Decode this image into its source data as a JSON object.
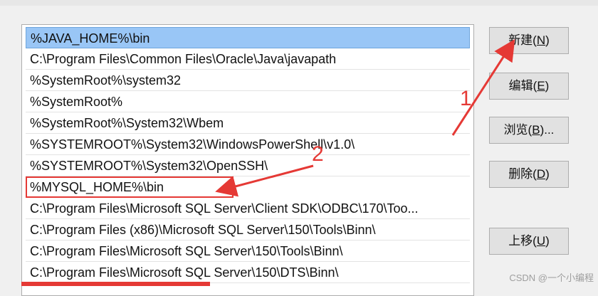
{
  "path_list": {
    "items": [
      "%JAVA_HOME%\\bin",
      "C:\\Program Files\\Common Files\\Oracle\\Java\\javapath",
      "%SystemRoot%\\system32",
      "%SystemRoot%",
      "%SystemRoot%\\System32\\Wbem",
      "%SYSTEMROOT%\\System32\\WindowsPowerShell\\v1.0\\",
      "%SYSTEMROOT%\\System32\\OpenSSH\\",
      "%MYSQL_HOME%\\bin",
      "C:\\Program Files\\Microsoft SQL Server\\Client SDK\\ODBC\\170\\Too...",
      "C:\\Program Files (x86)\\Microsoft SQL Server\\150\\Tools\\Binn\\",
      "C:\\Program Files\\Microsoft SQL Server\\150\\Tools\\Binn\\",
      "C:\\Program Files\\Microsoft SQL Server\\150\\DTS\\Binn\\"
    ],
    "selected_index": 0,
    "highlighted_index": 7
  },
  "buttons": {
    "new": {
      "text": "新建(",
      "key": "N",
      "end": ")"
    },
    "edit": {
      "text": "编辑(",
      "key": "E",
      "end": ")"
    },
    "browse": {
      "text": "浏览(",
      "key": "B",
      "end": ")..."
    },
    "delete": {
      "text": "删除(",
      "key": "D",
      "end": ")"
    },
    "move_up": {
      "text": "上移(",
      "key": "U",
      "end": ")"
    }
  },
  "annotations": {
    "step1": "1",
    "step2": "2"
  },
  "colors": {
    "selection": "#99c6f6",
    "annotation_red": "#e53935"
  },
  "watermark": "CSDN @一个小编程"
}
